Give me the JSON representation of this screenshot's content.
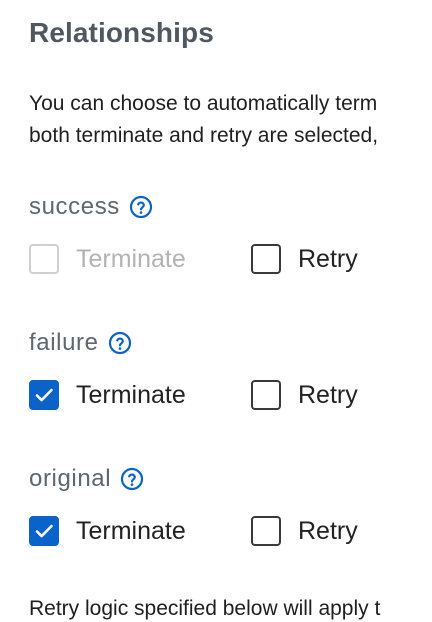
{
  "heading": "Relationships",
  "description": {
    "line1": "You can choose to automatically term",
    "line2": "both terminate and retry are selected,"
  },
  "relationships": [
    {
      "name": "success",
      "terminate": {
        "label": "Terminate",
        "checked": false,
        "disabled": true
      },
      "retry": {
        "label": "Retry",
        "checked": false,
        "disabled": false
      }
    },
    {
      "name": "failure",
      "terminate": {
        "label": "Terminate",
        "checked": true,
        "disabled": false
      },
      "retry": {
        "label": "Retry",
        "checked": false,
        "disabled": false
      }
    },
    {
      "name": "original",
      "terminate": {
        "label": "Terminate",
        "checked": true,
        "disabled": false
      },
      "retry": {
        "label": "Retry",
        "checked": false,
        "disabled": false
      }
    }
  ],
  "footer": "Retry logic specified below will apply t",
  "colors": {
    "accent": "#0b62c9",
    "heading": "#4f5760",
    "relationship_name": "#5f6670",
    "disabled": "#b3b3b3"
  }
}
